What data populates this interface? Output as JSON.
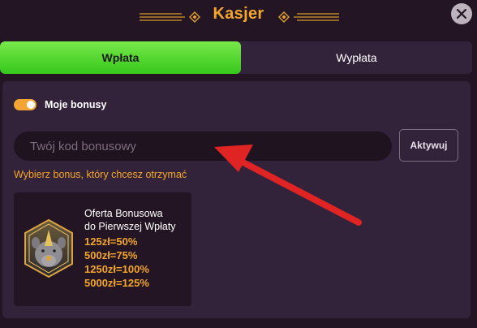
{
  "header": {
    "title": "Kasjer",
    "close_icon": "close-icon"
  },
  "tabs": [
    {
      "label": "Wpłata",
      "active": true
    },
    {
      "label": "Wypłata",
      "active": false
    }
  ],
  "bonuses": {
    "toggle_label": "Moje bonusy",
    "toggle_on": true,
    "code_input": {
      "placeholder": "Twój kod bonusowy",
      "value": ""
    },
    "activate_label": "Aktywuj",
    "hint": "Wybierz bonus, który chcesz otrzymać"
  },
  "bonus_card": {
    "title_line1": "Oferta Bonusowa",
    "title_line2": "do Pierwszej Wpłaty",
    "tiers": [
      "125zł=50%",
      "500zł=75%",
      "1250zł=100%",
      "5000zł=125%"
    ],
    "icon": "rhino-icon"
  },
  "colors": {
    "accent_orange": "#f4a62a",
    "active_tab_green": "#4fd62e",
    "background": "#231523",
    "panel": "#33233a",
    "annotation_arrow": "#e02424"
  }
}
